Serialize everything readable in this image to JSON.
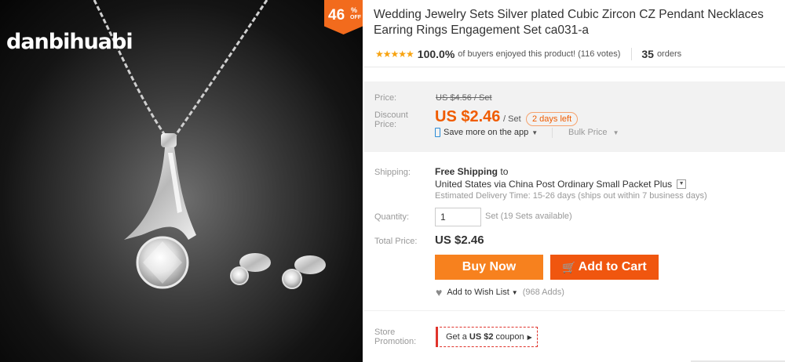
{
  "image": {
    "brand": "danbihuabi",
    "badge": {
      "number": "46",
      "percent": "%",
      "off": "OFF"
    }
  },
  "product": {
    "title": "Wedding Jewelry Sets Silver plated Cubic Zircon CZ Pendant Necklaces Earring Rings Engagement Set ca031-a",
    "stars": "★★★★★",
    "rating_percent": "100.0%",
    "rating_text": "of buyers enjoyed this product! (116 votes)",
    "orders_count": "35",
    "orders_label": "orders"
  },
  "pricing": {
    "price_label": "Price:",
    "original_price": "US $4.56 / Set",
    "discount_label_1": "Discount",
    "discount_label_2": "Price:",
    "discount_price": "US $2.46",
    "per_unit": "/ Set",
    "days_left": "2 days left",
    "app_text": "Save more on the app",
    "bulk_price": "Bulk Price"
  },
  "shipping": {
    "label": "Shipping:",
    "free_shipping": "Free Shipping",
    "to": "to",
    "via": "United States via China Post Ordinary Small Packet Plus",
    "delivery": "Estimated Delivery Time: 15-26 days (ships out within 7 business days)"
  },
  "quantity": {
    "label": "Quantity:",
    "value": "1",
    "available": "Set (19 Sets available)"
  },
  "total": {
    "label": "Total Price:",
    "value": "US $2.46"
  },
  "actions": {
    "buy_now": "Buy Now",
    "add_to_cart": "Add to Cart",
    "wishlist": "Add to Wish List",
    "wishlist_count": "(968 Adds)"
  },
  "promotion": {
    "label_1": "Store",
    "label_2": "Promotion:",
    "coupon_pre": "Get a",
    "coupon_amount": "US $2",
    "coupon_post": "coupon"
  },
  "colors": {
    "accent_orange": "#f7811e",
    "cart_red_orange": "#f0560f",
    "price_orange": "#f05c00",
    "star_gold": "#f7a311",
    "coupon_red": "#e0342c"
  }
}
